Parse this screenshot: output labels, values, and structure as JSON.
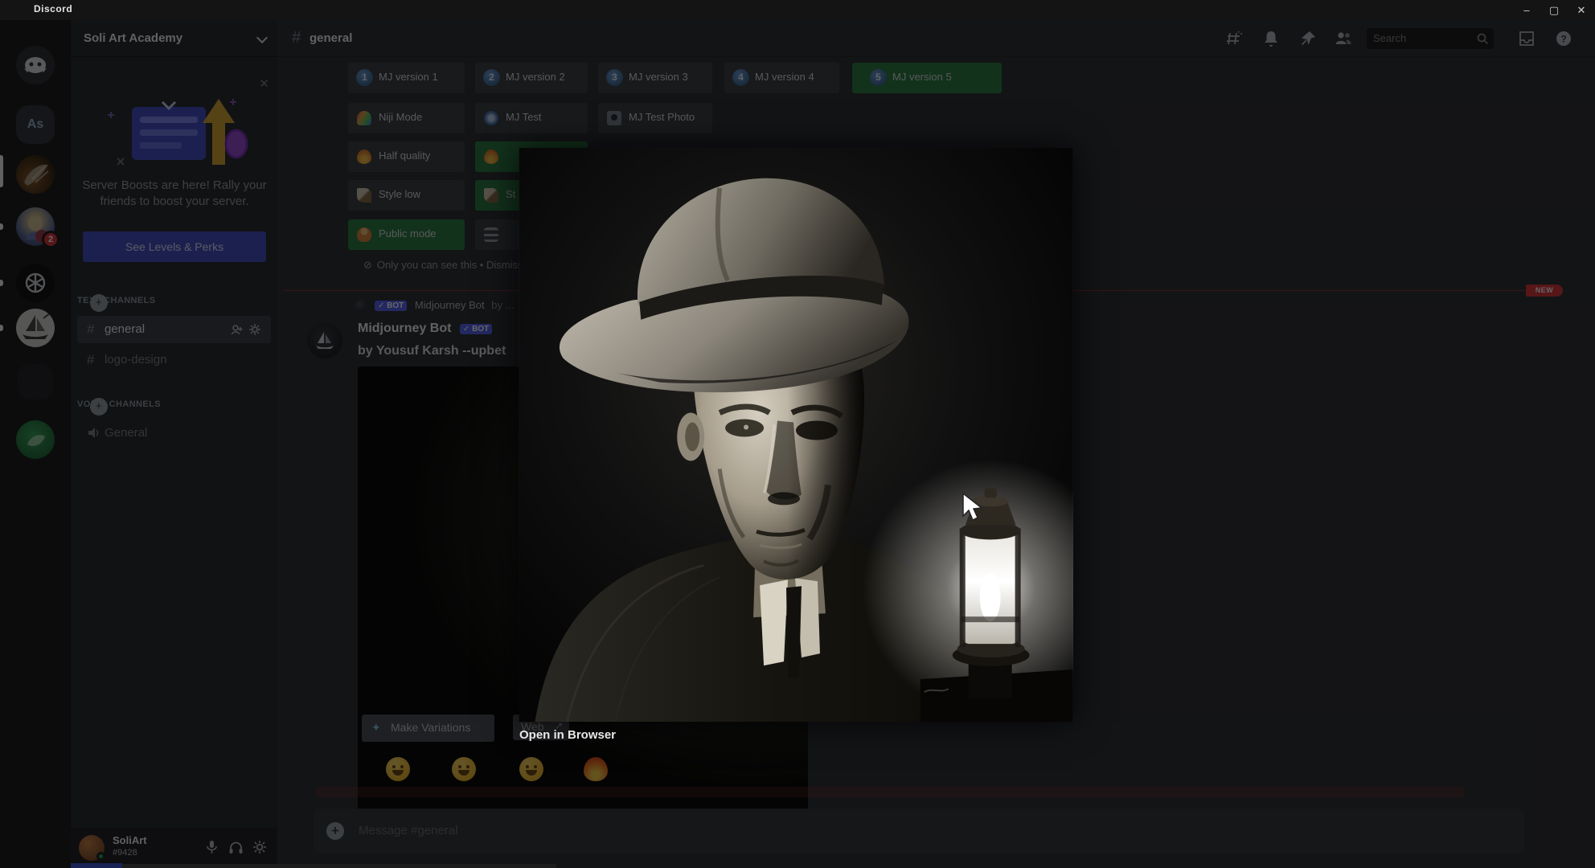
{
  "window": {
    "title": "Discord",
    "minimize": "–",
    "maximize": "▢",
    "close": "✕"
  },
  "colors": {
    "accent": "#5865f2",
    "success_green": "#2d7d46",
    "danger_red": "#da373c",
    "rail_bg": "#1e1f22",
    "sidebar_bg": "#2b2d31",
    "chat_bg": "#313338"
  },
  "rail": {
    "servers": [
      {
        "name": "discord-home"
      },
      {
        "name": "as-server",
        "initials": "As"
      },
      {
        "name": "soli-art-academy",
        "active": true
      },
      {
        "name": "wizard-server",
        "mention_count": "2"
      },
      {
        "name": "openai-server"
      },
      {
        "name": "midjourney-server"
      },
      {
        "name": "unknown-server"
      },
      {
        "name": "green-server"
      }
    ]
  },
  "sidebar": {
    "server_name": "Soli Art Academy",
    "boost": {
      "message": "Server Boosts are here! Rally your friends to boost your server.",
      "button": "See Levels & Perks",
      "close": "✕"
    },
    "text_section": "TEXT CHANNELS",
    "voice_section": "VOICE CHANNELS",
    "channels": {
      "general": "general",
      "logo_design": "logo-design",
      "voice_general": "General"
    },
    "user": {
      "name": "SoliArt",
      "tag": "#9428"
    }
  },
  "header": {
    "channel": "general",
    "search_placeholder": "Search"
  },
  "settings": {
    "rows": [
      [
        {
          "num": "1",
          "label": "MJ version 1"
        },
        {
          "num": "2",
          "label": "MJ version 2"
        },
        {
          "num": "3",
          "label": "MJ version 3"
        },
        {
          "num": "4",
          "label": "MJ version 4"
        },
        {
          "num": "5",
          "label": "MJ version 5"
        }
      ],
      [
        {
          "label": "Niji Mode"
        },
        {
          "label": "MJ Test"
        },
        {
          "label": "MJ Test Photo"
        }
      ],
      [
        {
          "label": "Half quality"
        },
        {
          "label": ""
        }
      ],
      [
        {
          "label": "Style low"
        },
        {
          "label": "St"
        }
      ],
      [
        {
          "label": "Public mode"
        },
        {
          "label": ""
        }
      ]
    ],
    "note": "Only you can see this • Dismiss message"
  },
  "chat": {
    "new_badge": "NEW",
    "reply": {
      "check": "✓",
      "bot": "BOT",
      "author": "Midjourney Bot",
      "preview": "by ..."
    },
    "message": {
      "author": "Midjourney Bot",
      "check": "✓",
      "bot": "BOT",
      "text": "by Yousuf Karsh --upbet"
    },
    "variations_button": "Make Variations",
    "web_button": "Web",
    "reactions": [
      "grin-emoji",
      "smile-emoji",
      "wink-emoji",
      "fire-emoji"
    ]
  },
  "modal": {
    "open_link": "Open in Browser"
  },
  "composer": {
    "placeholder": "Message #general"
  }
}
